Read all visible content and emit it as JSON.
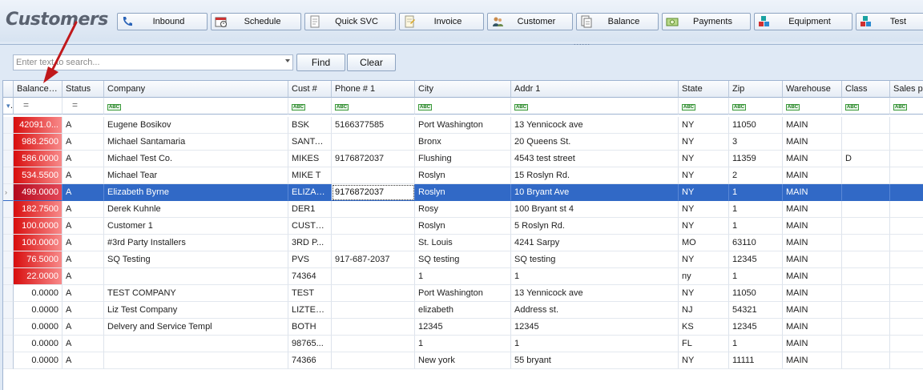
{
  "app": {
    "title": "Customers"
  },
  "nav": [
    {
      "label": "Inbound",
      "icon": "phone-icon"
    },
    {
      "label": "Schedule",
      "icon": "calendar-icon"
    },
    {
      "label": "Quick SVC",
      "icon": "document-icon"
    },
    {
      "label": "Invoice",
      "icon": "invoice-icon"
    },
    {
      "label": "Customer",
      "icon": "people-icon"
    },
    {
      "label": "Balance",
      "icon": "balance-icon"
    },
    {
      "label": "Payments",
      "icon": "cash-icon"
    },
    {
      "label": "Equipment",
      "icon": "boxes-icon"
    },
    {
      "label": "Test",
      "icon": "boxes-icon"
    }
  ],
  "search": {
    "placeholder": "Enter text to search...",
    "value": "",
    "find_label": "Find",
    "clear_label": "Clear"
  },
  "grid": {
    "columns": [
      "Balance",
      "Status",
      "Company",
      "Cust #",
      "Phone # 1",
      "City",
      "Addr 1",
      "State",
      "Zip",
      "Warehouse",
      "Class",
      "Sales pe"
    ],
    "sorted_column": "Balance",
    "filter_row": [
      "=",
      "=",
      "ABC",
      "ABC",
      "ABC",
      "ABC",
      "ABC",
      "ABC",
      "ABC",
      "ABC",
      "ABC",
      "ABC"
    ],
    "selected_row": 4,
    "highlight_color": "#e02020",
    "selection_color": "#3169c6",
    "rows": [
      [
        "42091.0...",
        "A",
        "Eugene Bosikov",
        "BSK",
        "5166377585",
        "Port Washington",
        "13 Yennicock ave",
        "NY",
        "11050",
        "MAIN",
        "",
        ""
      ],
      [
        "988.2500",
        "A",
        "Michael Santamaria",
        "SANTA...",
        "",
        "Bronx",
        "20 Queens St.",
        "NY",
        "3",
        "MAIN",
        "",
        ""
      ],
      [
        "586.0000",
        "A",
        "Michael Test Co.",
        "MIKES",
        "9176872037",
        "Flushing",
        "4543 test street",
        "NY",
        "11359",
        "MAIN",
        "D",
        ""
      ],
      [
        "534.5500",
        "A",
        "Michael Tear",
        "MIKE T",
        "",
        "Roslyn",
        "15 Roslyn Rd.",
        "NY",
        "2",
        "MAIN",
        "",
        ""
      ],
      [
        "499.0000",
        "A",
        "Elizabeth Byrne",
        "ELIZAB...",
        "9176872037",
        "Roslyn",
        "10 Bryant Ave",
        "NY",
        "1",
        "MAIN",
        "",
        ""
      ],
      [
        "182.7500",
        "A",
        "Derek Kuhnle",
        "DER1",
        "",
        "Rosy",
        "100 Bryant st 4",
        "NY",
        "1",
        "MAIN",
        "",
        ""
      ],
      [
        "100.0000",
        "A",
        "Customer 1",
        "CUSTO...",
        "",
        "Roslyn",
        "5 Roslyn Rd.",
        "NY",
        "1",
        "MAIN",
        "",
        ""
      ],
      [
        "100.0000",
        "A",
        "#3rd Party Installers",
        "3RD P...",
        "",
        "St. Louis",
        "4241 Sarpy",
        "MO",
        "63110",
        "MAIN",
        "",
        ""
      ],
      [
        "76.5000",
        "A",
        "SQ Testing",
        "PVS",
        "917-687-2037",
        "SQ testing",
        "SQ testing",
        "NY",
        "12345",
        "MAIN",
        "",
        ""
      ],
      [
        "22.0000",
        "A",
        "",
        "74364",
        "",
        "1",
        "1",
        "ny",
        "1",
        "MAIN",
        "",
        ""
      ],
      [
        "0.0000",
        "A",
        "TEST COMPANY",
        "TEST",
        "",
        "Port Washington",
        "13 Yennicock ave",
        "NY",
        "11050",
        "MAIN",
        "",
        ""
      ],
      [
        "0.0000",
        "A",
        "Liz Test Company",
        "LIZTES...",
        "",
        "elizabeth",
        "Address st.",
        "NJ",
        "54321",
        "MAIN",
        "",
        ""
      ],
      [
        "0.0000",
        "A",
        "Delvery and Service Templ",
        "BOTH",
        "",
        "12345",
        "12345",
        "KS",
        "12345",
        "MAIN",
        "",
        ""
      ],
      [
        "0.0000",
        "A",
        "",
        "98765...",
        "",
        "1",
        "1",
        "FL",
        "1",
        "MAIN",
        "",
        ""
      ],
      [
        "0.0000",
        "A",
        "",
        "74366",
        "",
        "New york",
        "55 bryant",
        "NY",
        "11111",
        "MAIN",
        "",
        ""
      ]
    ]
  }
}
